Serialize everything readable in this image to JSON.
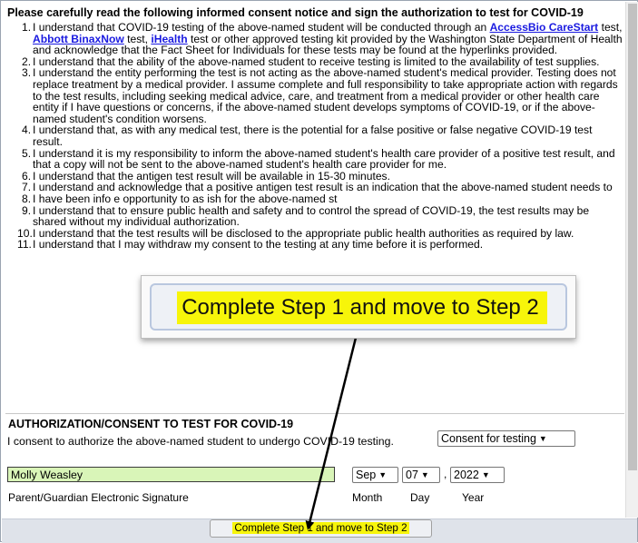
{
  "notice": {
    "title": "Please carefully read the following informed consent notice and sign the authorization to test for COVID-19"
  },
  "terms": [
    {
      "num": "1.",
      "parts": [
        {
          "t": "I understand that COVID-19 testing of the above-named student will be conducted through an "
        },
        {
          "link": "AccessBio CareStart"
        },
        {
          "t": " test, "
        },
        {
          "link": "Abbott BinaxNow"
        },
        {
          "t": " test, "
        },
        {
          "link": "iHealth"
        },
        {
          "t": " test or other approved testing kit  provided by the Washington State Department of Health and acknowledge that the Fact Sheet for Individuals for these tests may be found at the hyperlinks provided."
        }
      ]
    },
    {
      "num": "2.",
      "parts": [
        {
          "t": "I understand that the ability of the above-named student to receive testing is limited to the availability of test supplies."
        }
      ]
    },
    {
      "num": "3.",
      "parts": [
        {
          "t": "I understand the entity performing the test is not acting as the above-named student's medical provider. Testing does not replace treatment by a medical provider. I assume complete and full responsibility to take appropriate action with regards to the test results, including seeking medical advice, care, and treatment from a medical provider or other health care entity if I have questions or concerns, if the above-named student develops symptoms of COVID-19, or if the above-named student's condition worsens."
        }
      ]
    },
    {
      "num": "4.",
      "parts": [
        {
          "t": "I understand that, as with any medical test, there is the potential for a false positive or false negative COVID-19 test result."
        }
      ]
    },
    {
      "num": "5.",
      "parts": [
        {
          "t": "I understand it is my responsibility to inform the above-named student's health care provider of a positive test result, and that a copy will not be sent to the above-named student's health care provider for me."
        }
      ]
    },
    {
      "num": "6.",
      "parts": [
        {
          "t": "I understand that the antigen test result will be available in 15-30 minutes."
        }
      ]
    },
    {
      "num": "7.",
      "parts": [
        {
          "t": "I understand and acknowledge that a positive antigen test result is an indication that the above-named student needs to"
        }
      ]
    },
    {
      "num": "8.",
      "parts": [
        {
          "t": "I have been info                                                                                          e opportunity to as                                                                                        ish for the above-named st"
        }
      ]
    },
    {
      "num": "9.",
      "parts": [
        {
          "t": "I understand that to ensure public health and safety and to control the spread of COVID-19, the test results may be shared without my individual authorization."
        }
      ]
    },
    {
      "num": "10.",
      "parts": [
        {
          "t": "I understand that the test results will be disclosed to the appropriate public health authorities as required by law."
        }
      ]
    },
    {
      "num": "11.",
      "parts": [
        {
          "t": "I understand that I may withdraw my consent to the testing at any time before it is performed."
        }
      ]
    }
  ],
  "authorization": {
    "title": "AUTHORIZATION/CONSENT TO TEST FOR COVID-19",
    "text": "I consent to authorize the above-named student to undergo COVID-19 testing.",
    "consent_select": "Consent for testing"
  },
  "signature": {
    "value": "Molly Weasley",
    "label": "Parent/Guardian Electronic Signature",
    "month": "Sep",
    "day": "07",
    "year": "2022",
    "month_label": "Month",
    "day_label": "Day",
    "year_label": "Year",
    "separator": ","
  },
  "button": {
    "label": "Complete Step 1 and move to Step 2"
  },
  "callout": {
    "label": "Complete Step 1 and move to Step 2",
    "highlight_color": "#f7f50a"
  },
  "icons": {
    "select": "chevron-down-icon"
  }
}
